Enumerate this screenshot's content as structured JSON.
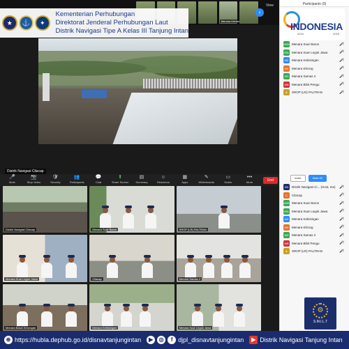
{
  "header": {
    "line1": "Kementerian Perhubungan",
    "line2": "Direktorat Jenderal Perhubungan Laut",
    "line3": "Distrik Navigasi Tipe A Kelas III Tanjung Intan"
  },
  "top_strip": {
    "view_label": "View",
    "thumbs": [
      "",
      "",
      "",
      "",
      "Menara Kebisingan",
      ""
    ]
  },
  "main_video": {
    "label": "Distrik Navigasi Cilacap"
  },
  "toolbar": {
    "items": [
      {
        "icon": "🎤",
        "label": "Mute"
      },
      {
        "icon": "📷",
        "label": "Stop Video"
      },
      {
        "icon": "🛡",
        "label": "Security"
      },
      {
        "icon": "👥",
        "label": "Participants"
      },
      {
        "icon": "💬",
        "label": "Chat"
      },
      {
        "icon": "⬆",
        "label": "Share Screen"
      },
      {
        "icon": "▤",
        "label": "Summary"
      },
      {
        "icon": "☺",
        "label": "Reactions"
      },
      {
        "icon": "▦",
        "label": "Apps"
      },
      {
        "icon": "✎",
        "label": "Whiteboards"
      },
      {
        "icon": "▭",
        "label": "Notes"
      },
      {
        "icon": "•••",
        "label": "More"
      }
    ],
    "end_label": "End"
  },
  "gallery": [
    {
      "name": "Distrik Navigasi Cilacap",
      "speaking": true
    },
    {
      "name": "Menara Suar Baron"
    },
    {
      "name": "SROP (LR) PALTRAN"
    },
    {
      "name": "Menara Suar Legon Jawa"
    },
    {
      "name": "Cilacap"
    },
    {
      "name": "Menara Samas 2"
    },
    {
      "name": "Menara Bawa Kerungan"
    },
    {
      "name": "Menara Kebisingan"
    },
    {
      "name": "Menara Suar Legok Jawa"
    }
  ],
  "panel": {
    "title": "Participants (9)",
    "indonesia": {
      "word": "INDONESIA",
      "year_start": "2024",
      "year_end": "2025"
    },
    "participants_top": [
      {
        "abbr": "MSB",
        "name": "Menara Suar Baron",
        "color": "#3aa757"
      },
      {
        "abbr": "MSL",
        "name": "Menara Suar Legok Jawa",
        "color": "#3aa757"
      },
      {
        "abbr": "MK",
        "name": "Menara Kebisingan",
        "color": "#2d8cff"
      },
      {
        "abbr": "MK",
        "name": "Menara Klirong",
        "color": "#e8742c"
      },
      {
        "abbr": "MS",
        "name": "Menara Samas 2",
        "color": "#3aa757"
      },
      {
        "abbr": "MB",
        "name": "Menara Bibit Pengu",
        "color": "#d13438"
      },
      {
        "abbr": "●",
        "name": "SROP (LR) PALTRAN",
        "color": "#c9a227"
      }
    ],
    "invite_label": "Invite",
    "mute_all_label": "Mute All",
    "participants_bottom": [
      {
        "abbr": "DN",
        "name": "Distrik Navigasi Ci... (Host, me)",
        "color": "#1a2c6e"
      },
      {
        "abbr": "C",
        "name": "Cilacap",
        "color": "#e8742c"
      },
      {
        "abbr": "MSB",
        "name": "Menara Suar Baron",
        "color": "#3aa757"
      },
      {
        "abbr": "MSL",
        "name": "Menara Suar Legok Jawa",
        "color": "#3aa757"
      },
      {
        "abbr": "MK",
        "name": "Menara Kebisingan",
        "color": "#2d8cff"
      },
      {
        "abbr": "MK",
        "name": "Menara Klirong",
        "color": "#e8742c"
      },
      {
        "abbr": "MS",
        "name": "Menara Samas 2",
        "color": "#3aa757"
      },
      {
        "abbr": "MB",
        "name": "Menara Bibit Pengu",
        "color": "#d13438"
      },
      {
        "abbr": "●",
        "name": "SROP (LR) PALTRAN",
        "color": "#c9a227"
      }
    ],
    "smilt": "S.M.I.L.T"
  },
  "footer": {
    "website": "https://hubla.dephub.go.id/disnavtanjungintan",
    "social": "djpl_disnavtanjungintan",
    "brand": "Distrik Navigasi Tanjung Intan"
  }
}
